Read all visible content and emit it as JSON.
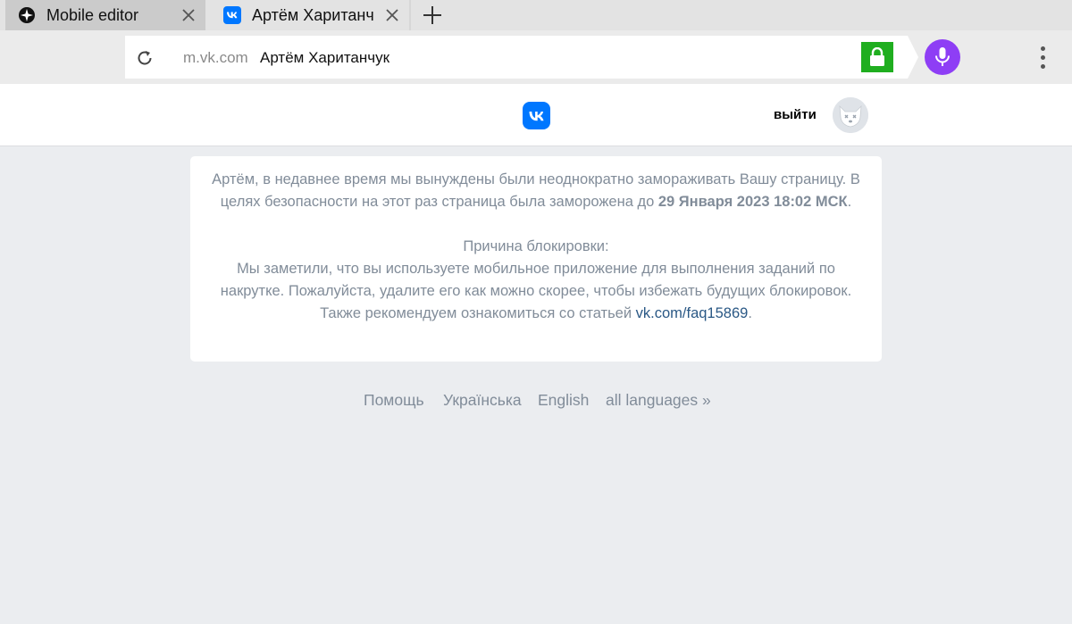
{
  "browser": {
    "tabs": [
      {
        "title": "Mobile editor",
        "favicon": "compass-icon",
        "active": false
      },
      {
        "title": "Артём Хаританч",
        "favicon": "vk-icon",
        "active": true
      }
    ],
    "address": {
      "domain": "m.vk.com",
      "page_title": "Артём Хаританчук"
    },
    "colors": {
      "lock": "#1fae1f",
      "mic": "#8e3ef5"
    }
  },
  "header": {
    "logo": "vk-logo-icon",
    "logout_label": "выйти"
  },
  "notice": {
    "intro": "Артём, в недавнее время мы вынуждены были неоднократно замораживать Вашу страницу. В целях безопасности на этот раз страница была заморожена до ",
    "frozen_until": "29 Января 2023 18:02 МСК",
    "intro_end": ".",
    "reason_title": "Причина блокировки:",
    "reason_text": "Мы заметили, что вы используете мобильное приложение для выполнения заданий по накрутке. Пожалуйста, удалите его как можно скорее, чтобы избежать будущих блокировок. Также рекомендуем ознакомиться со статьей ",
    "faq_link": "vk.com/faq15869",
    "reason_end": "."
  },
  "footer": {
    "links": [
      "Помощь",
      "Українська",
      "English",
      "all languages »"
    ]
  }
}
